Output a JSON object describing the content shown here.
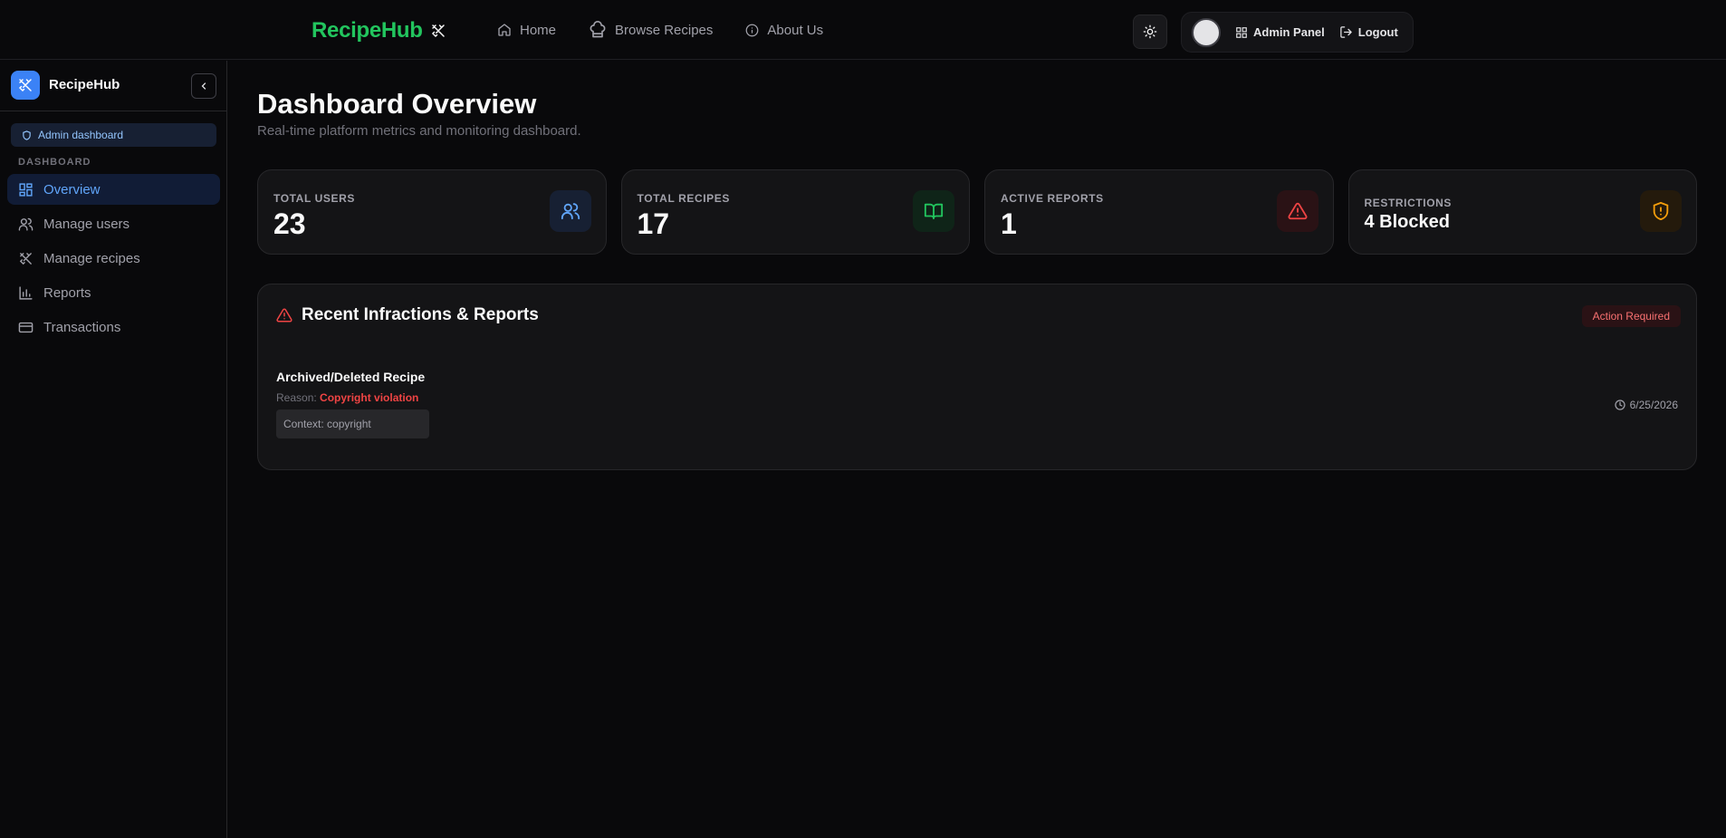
{
  "topbar": {
    "brand": "RecipeHub",
    "nav": [
      {
        "label": "Home",
        "icon": "home-icon"
      },
      {
        "label": "Browse Recipes",
        "icon": "chef-hat-icon"
      },
      {
        "label": "About Us",
        "icon": "info-icon"
      }
    ],
    "admin_panel": "Admin Panel",
    "logout": "Logout"
  },
  "sidebar": {
    "title": "RecipeHub",
    "badge": "Admin dashboard",
    "section": "DASHBOARD",
    "items": [
      {
        "label": "Overview",
        "icon": "grid-icon",
        "active": true
      },
      {
        "label": "Manage users",
        "icon": "users-icon"
      },
      {
        "label": "Manage recipes",
        "icon": "utensils-icon"
      },
      {
        "label": "Reports",
        "icon": "bar-chart-icon"
      },
      {
        "label": "Transactions",
        "icon": "credit-card-icon"
      }
    ]
  },
  "main": {
    "title": "Dashboard Overview",
    "subtitle": "Real-time platform metrics and monitoring dashboard.",
    "stats": [
      {
        "label": "TOTAL USERS",
        "value": "23",
        "color": "#60a5fa",
        "icon": "users-icon"
      },
      {
        "label": "TOTAL RECIPES",
        "value": "17",
        "color": "#22c55e",
        "icon": "book-open-icon"
      },
      {
        "label": "ACTIVE REPORTS",
        "value": "1",
        "color": "#ef4444",
        "icon": "alert-triangle-icon"
      },
      {
        "label": "RESTRICTIONS",
        "value": "4 Blocked",
        "color": "#f59e0b",
        "icon": "shield-alert-icon"
      }
    ],
    "panel": {
      "title": "Recent Infractions & Reports",
      "badge": "Action Required",
      "report": {
        "title": "Archived/Deleted Recipe",
        "reason_label": "Reason:",
        "reason": "Copyright violation",
        "context": "Context: copyright",
        "date": "6/25/2026"
      }
    }
  }
}
